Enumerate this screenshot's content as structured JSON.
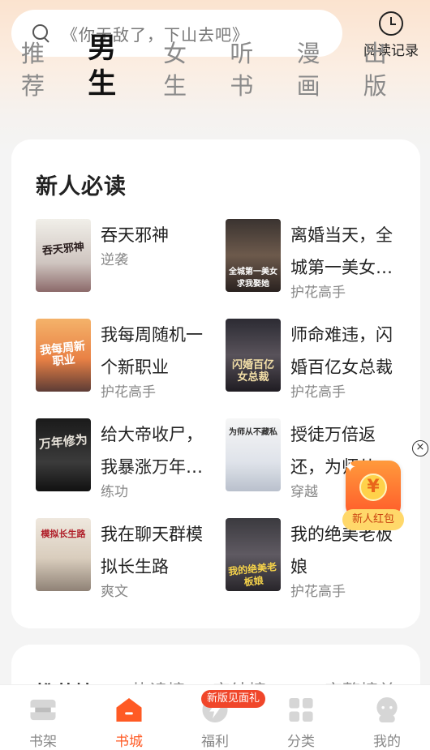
{
  "search": {
    "placeholder": "《你无敌了，下山去吧》",
    "icon": "search-icon"
  },
  "history": {
    "label": "阅读记录",
    "icon": "clock-icon"
  },
  "tabs": [
    {
      "label": "推荐",
      "active": false
    },
    {
      "label": "男生",
      "active": true
    },
    {
      "label": "女生",
      "active": false
    },
    {
      "label": "听书",
      "active": false
    },
    {
      "label": "漫画",
      "active": false
    },
    {
      "label": "出版",
      "active": false
    }
  ],
  "section": {
    "title": "新人必读",
    "books": [
      {
        "title": "吞天邪神",
        "category": "逆袭",
        "cover_text": "吞天邪神"
      },
      {
        "title": "离婚当天，全城第一美女…",
        "category": "护花高手",
        "cover_text": "全城第一美女求我娶她"
      },
      {
        "title": "我每周随机一个新职业",
        "category": "护花高手",
        "cover_text": "我每周新职业"
      },
      {
        "title": "师命难违，闪婚百亿女总裁",
        "category": "护花高手",
        "cover_text": "闪婚百亿女总裁"
      },
      {
        "title": "给大帝收尸，我暴涨万年…",
        "category": "练功",
        "cover_text": "万年修为"
      },
      {
        "title": "授徒万倍返还，为师从…",
        "category": "穿越",
        "cover_text": "为师从不藏私"
      },
      {
        "title": "我在聊天群模拟长生路",
        "category": "爽文",
        "cover_text": "模拟长生路"
      },
      {
        "title": "我的绝美老板娘",
        "category": "护花高手",
        "cover_text": "我的绝美老板娘"
      }
    ]
  },
  "next_section": {
    "labels": [
      "推荐榜",
      "热读榜",
      "完结榜",
      "完整榜单"
    ]
  },
  "float": {
    "close": "×",
    "coin": "¥",
    "label": "新人红包"
  },
  "nav": {
    "items": [
      {
        "label": "书架",
        "icon": "bookshelf-icon"
      },
      {
        "label": "书城",
        "icon": "bookstore-icon",
        "active": true
      },
      {
        "label": "福利",
        "icon": "lightning-icon",
        "badge": "新版见面礼"
      },
      {
        "label": "分类",
        "icon": "category-grid-icon"
      },
      {
        "label": "我的",
        "icon": "profile-icon"
      }
    ]
  },
  "colors": {
    "accent": "#ff5a24",
    "badge": "#f0462a",
    "header_tint": "#fbe3cf"
  }
}
